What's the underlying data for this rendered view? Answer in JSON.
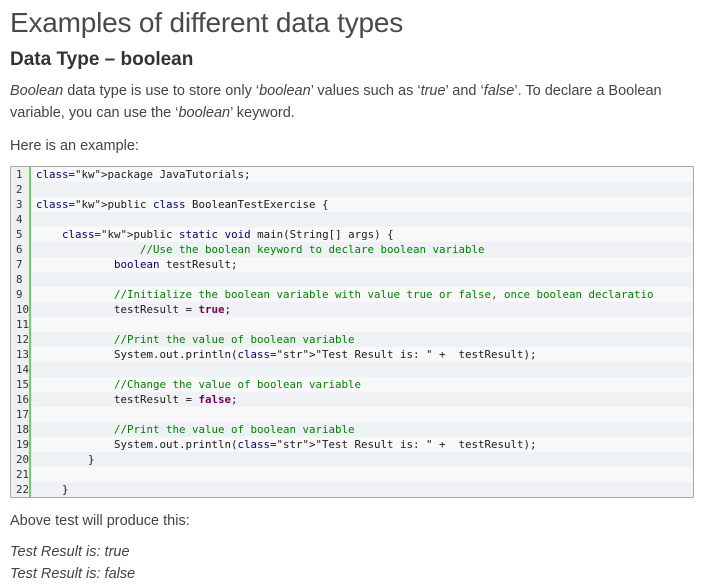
{
  "page_title": "Examples of different data types",
  "section_title": "Data Type – boolean",
  "intro": {
    "em1": "Boolean",
    "t1": " data type is use to store only ‘",
    "em2": "boolean",
    "t2": "’ values such as ‘",
    "em3": "true",
    "t3": "’ and ‘",
    "em4": "false",
    "t4": "’. To declare a Boolean variable, you can use the ‘",
    "em5": "boolean",
    "t5": "’ keyword."
  },
  "example_intro": "Here is an example:",
  "code_lines": [
    {
      "num": "1",
      "text": "package JavaTutorials;"
    },
    {
      "num": "2",
      "text": ""
    },
    {
      "num": "3",
      "text": "public class BooleanTestExercise {"
    },
    {
      "num": "4",
      "text": ""
    },
    {
      "num": "5",
      "text": "    public static void main(String[] args) {"
    },
    {
      "num": "6",
      "text": "                //Use the boolean keyword to declare boolean variable"
    },
    {
      "num": "7",
      "text": "            boolean testResult;"
    },
    {
      "num": "8",
      "text": ""
    },
    {
      "num": "9",
      "text": "            //Initialize the boolean variable with value true or false, once boolean declaratio"
    },
    {
      "num": "10",
      "text": "            testResult = true;"
    },
    {
      "num": "11",
      "text": ""
    },
    {
      "num": "12",
      "text": "            //Print the value of boolean variable"
    },
    {
      "num": "13",
      "text": "            System.out.println(\"Test Result is: \" +  testResult);"
    },
    {
      "num": "14",
      "text": ""
    },
    {
      "num": "15",
      "text": "            //Change the value of boolean variable"
    },
    {
      "num": "16",
      "text": "            testResult = false;"
    },
    {
      "num": "17",
      "text": ""
    },
    {
      "num": "18",
      "text": "            //Print the value of boolean variable"
    },
    {
      "num": "19",
      "text": "            System.out.println(\"Test Result is: \" +  testResult);"
    },
    {
      "num": "20",
      "text": "        }"
    },
    {
      "num": "21",
      "text": ""
    },
    {
      "num": "22",
      "text": "    }"
    }
  ],
  "output_intro": "Above test will produce this:",
  "output_lines": [
    "Test Result is: true",
    "Test Result is: false"
  ]
}
